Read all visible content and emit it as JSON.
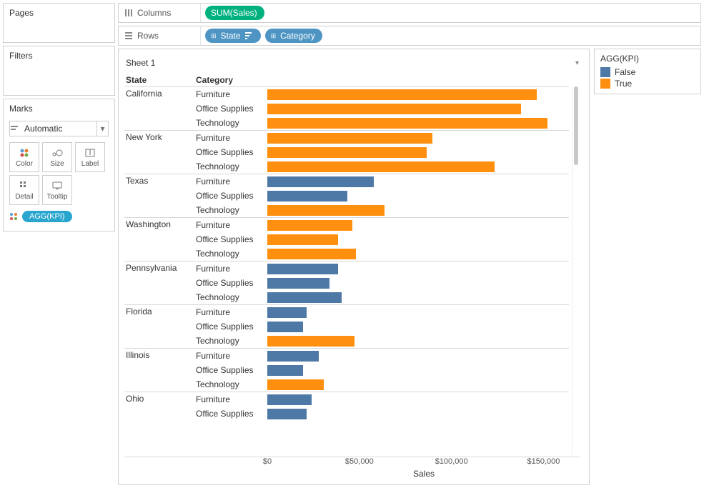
{
  "panels": {
    "pages": "Pages",
    "filters": "Filters",
    "marks": "Marks"
  },
  "marks": {
    "type": "Automatic",
    "cards": {
      "color": "Color",
      "size": "Size",
      "label": "Label",
      "detail": "Detail",
      "tooltip": "Tooltip"
    },
    "assigned": [
      {
        "target": "color",
        "field": "AGG(KPI)"
      }
    ]
  },
  "shelves": {
    "columns_label": "Columns",
    "rows_label": "Rows",
    "columns": [
      {
        "label": "SUM(Sales)",
        "color": "green"
      }
    ],
    "rows": [
      {
        "label": "State",
        "color": "blue",
        "expand": true,
        "sort": true
      },
      {
        "label": "Category",
        "color": "blue",
        "expand": true
      }
    ]
  },
  "viz": {
    "title": "Sheet 1",
    "row_headers": {
      "state": "State",
      "category": "Category"
    },
    "x_axis_label": "Sales"
  },
  "legend": {
    "title": "AGG(KPI)",
    "items": [
      {
        "label": "False",
        "color": "#4e79a7"
      },
      {
        "label": "True",
        "color": "#ff8f0e"
      }
    ]
  },
  "colors": {
    "true": "#ff8f0e",
    "false": "#4e79a7"
  },
  "chart_data": {
    "type": "bar",
    "xlabel": "Sales",
    "xlim": [
      0,
      170000
    ],
    "ticks": [
      0,
      50000,
      100000,
      150000
    ],
    "tick_labels": [
      "$0",
      "$50,000",
      "$100,000",
      "$150,000"
    ],
    "series_field": "AGG(KPI)",
    "groups": [
      {
        "state": "California",
        "rows": [
          {
            "category": "Furniture",
            "value": 152000,
            "kpi": true
          },
          {
            "category": "Office Supplies",
            "value": 143000,
            "kpi": true
          },
          {
            "category": "Technology",
            "value": 158000,
            "kpi": true
          }
        ]
      },
      {
        "state": "New York",
        "rows": [
          {
            "category": "Furniture",
            "value": 93000,
            "kpi": true
          },
          {
            "category": "Office Supplies",
            "value": 90000,
            "kpi": true
          },
          {
            "category": "Technology",
            "value": 128000,
            "kpi": true
          }
        ]
      },
      {
        "state": "Texas",
        "rows": [
          {
            "category": "Furniture",
            "value": 60000,
            "kpi": false
          },
          {
            "category": "Office Supplies",
            "value": 45000,
            "kpi": false
          },
          {
            "category": "Technology",
            "value": 66000,
            "kpi": true
          }
        ]
      },
      {
        "state": "Washington",
        "rows": [
          {
            "category": "Furniture",
            "value": 48000,
            "kpi": true
          },
          {
            "category": "Office Supplies",
            "value": 40000,
            "kpi": true
          },
          {
            "category": "Technology",
            "value": 50000,
            "kpi": true
          }
        ]
      },
      {
        "state": "Pennsylvania",
        "rows": [
          {
            "category": "Furniture",
            "value": 40000,
            "kpi": false
          },
          {
            "category": "Office Supplies",
            "value": 35000,
            "kpi": false
          },
          {
            "category": "Technology",
            "value": 42000,
            "kpi": false
          }
        ]
      },
      {
        "state": "Florida",
        "rows": [
          {
            "category": "Furniture",
            "value": 22000,
            "kpi": false
          },
          {
            "category": "Office Supplies",
            "value": 20000,
            "kpi": false
          },
          {
            "category": "Technology",
            "value": 49000,
            "kpi": true
          }
        ]
      },
      {
        "state": "Illinois",
        "rows": [
          {
            "category": "Furniture",
            "value": 29000,
            "kpi": false
          },
          {
            "category": "Office Supplies",
            "value": 20000,
            "kpi": false
          },
          {
            "category": "Technology",
            "value": 32000,
            "kpi": true
          }
        ]
      },
      {
        "state": "Ohio",
        "rows": [
          {
            "category": "Furniture",
            "value": 25000,
            "kpi": false
          },
          {
            "category": "Office Supplies",
            "value": 22000,
            "kpi": false
          }
        ]
      }
    ]
  }
}
